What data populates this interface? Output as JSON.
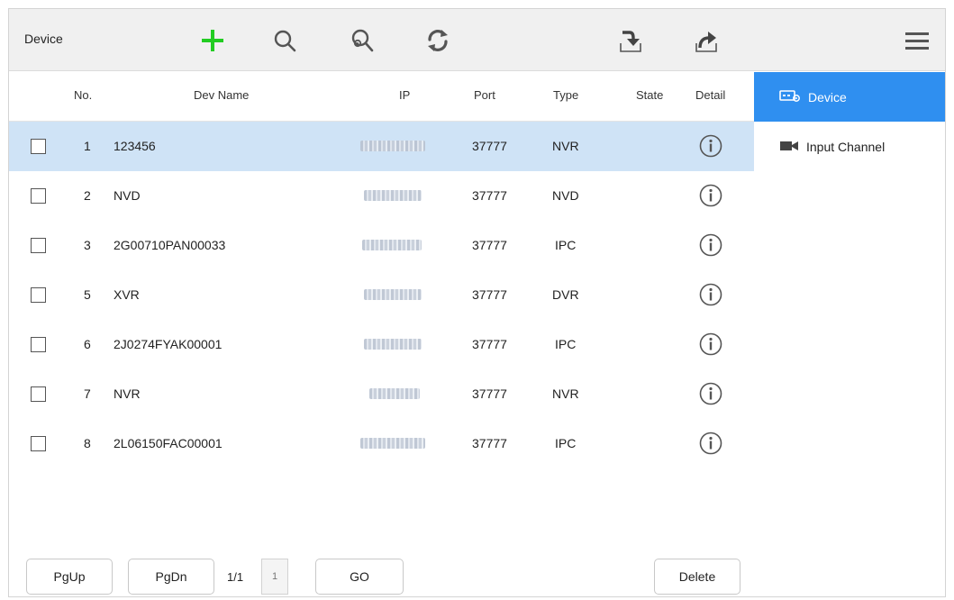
{
  "toolbar": {
    "title": "Device",
    "icons": [
      "add-icon",
      "search-icon",
      "advanced-search-icon",
      "refresh-icon",
      "import-icon",
      "export-icon",
      "menu-icon"
    ],
    "accent_add": "#22cc22"
  },
  "table": {
    "headers": {
      "no": "No.",
      "name": "Dev Name",
      "ip": "IP",
      "port": "Port",
      "type": "Type",
      "state": "State",
      "detail": "Detail"
    },
    "rows": [
      {
        "no": "1",
        "name": "123456",
        "port": "37777",
        "type": "NVR",
        "state": "",
        "selected": true
      },
      {
        "no": "2",
        "name": "NVD",
        "port": "37777",
        "type": "NVD",
        "state": "",
        "selected": false
      },
      {
        "no": "3",
        "name": "2G00710PAN00033",
        "port": "37777",
        "type": "IPC",
        "state": "",
        "selected": false
      },
      {
        "no": "5",
        "name": "XVR",
        "port": "37777",
        "type": "DVR",
        "state": "",
        "selected": false
      },
      {
        "no": "6",
        "name": "2J0274FYAK00001",
        "port": "37777",
        "type": "IPC",
        "state": "",
        "selected": false
      },
      {
        "no": "7",
        "name": "NVR",
        "port": "37777",
        "type": "NVR",
        "state": "",
        "selected": false
      },
      {
        "no": "8",
        "name": "2L06150FAC00001",
        "port": "37777",
        "type": "IPC",
        "state": "",
        "selected": false
      }
    ]
  },
  "side": {
    "items": [
      {
        "label": "Device",
        "icon": "device-icon",
        "active": true
      },
      {
        "label": "Input Channel",
        "icon": "camera-icon",
        "active": false
      }
    ],
    "active_color": "#2f8ff0"
  },
  "footer": {
    "pgup": "PgUp",
    "pgdn": "PgDn",
    "page_indicator": "1/1",
    "page_input_placeholder": "1",
    "go": "GO",
    "delete": "Delete"
  }
}
